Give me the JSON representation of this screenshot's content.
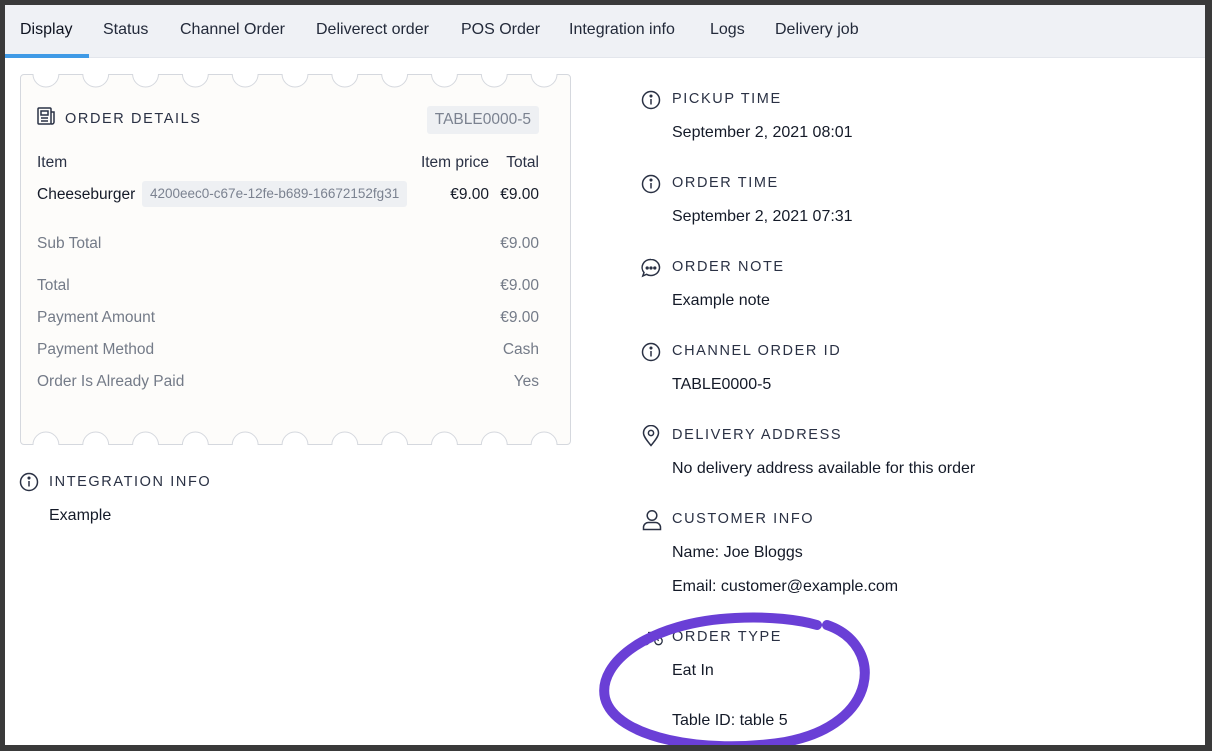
{
  "tabs": [
    {
      "label": "Display"
    },
    {
      "label": "Status"
    },
    {
      "label": "Channel Order"
    },
    {
      "label": "Deliverect order"
    },
    {
      "label": "POS Order"
    },
    {
      "label": "Integration info"
    },
    {
      "label": "Logs"
    },
    {
      "label": "Delivery job"
    }
  ],
  "active_tab": "Display",
  "accent_color": "#3f9ae6",
  "annotation_color": "#6a3fd6",
  "order_details": {
    "title": "ORDER DETAILS",
    "channel_order_badge": "TABLE0000-5",
    "columns": {
      "item": "Item",
      "item_price": "Item price",
      "total": "Total"
    },
    "items": [
      {
        "name": "Cheeseburger",
        "id": "4200eec0-c67e-12fe-b689-16672152fg31",
        "price": "€9.00",
        "total": "€9.00"
      }
    ],
    "sub_total": {
      "label": "Sub Total",
      "value": "€9.00"
    },
    "summary": [
      {
        "label": "Total",
        "value": "€9.00"
      },
      {
        "label": "Payment Amount",
        "value": "€9.00"
      },
      {
        "label": "Payment Method",
        "value": "Cash"
      },
      {
        "label": "Order Is Already Paid",
        "value": "Yes"
      }
    ]
  },
  "integration_info": {
    "title": "INTEGRATION INFO",
    "value": "Example"
  },
  "details": {
    "pickup_time": {
      "title": "PICKUP TIME",
      "value": "September 2, 2021 08:01",
      "icon": "info-icon"
    },
    "order_time": {
      "title": "ORDER TIME",
      "value": "September 2, 2021 07:31",
      "icon": "info-icon"
    },
    "order_note": {
      "title": "ORDER NOTE",
      "value": "Example note",
      "icon": "chat-bubble-icon"
    },
    "channel_order_id": {
      "title": "CHANNEL ORDER ID",
      "value": "TABLE0000-5",
      "icon": "info-icon"
    },
    "delivery_address": {
      "title": "DELIVERY ADDRESS",
      "value": "No delivery address available for this order",
      "icon": "map-pin-icon"
    },
    "customer_info": {
      "title": "CUSTOMER INFO",
      "name": "Name: Joe Bloggs",
      "email": "Email: customer@example.com",
      "icon": "user-icon"
    },
    "order_type": {
      "title": "ORDER TYPE",
      "value": "Eat In",
      "table_id": "Table ID: table 5",
      "icon": "bicycle-icon"
    }
  }
}
